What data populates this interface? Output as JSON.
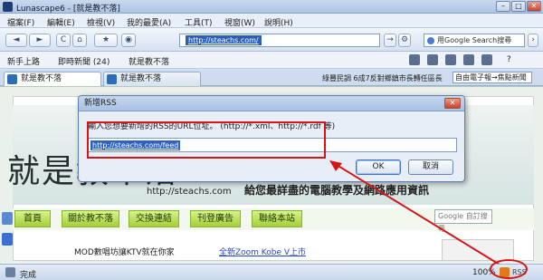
{
  "window": {
    "title": "Lunascape6 - [就是教不落]",
    "minimize": "–",
    "maximize": "□",
    "close": "✕"
  },
  "menu": [
    "檔案(F)",
    "編輯(E)",
    "檢視(V)",
    "我的最愛(A)",
    "工具(T)",
    "視窗(W)",
    "說明(H)"
  ],
  "toolbar": {
    "back": "◄",
    "forward": "►",
    "reload": "C",
    "home": "⌂",
    "favorites": "★",
    "address": "http://steachs.com/",
    "go": "→",
    "stop": "◉",
    "search_placeholder": "用Google Search搜尋"
  },
  "links_bar": {
    "items": [
      "新手上路",
      "即時新聞 (24)",
      "就是教不落"
    ]
  },
  "tabs": [
    {
      "label": "就是教不落"
    },
    {
      "label": "就是教不落"
    }
  ],
  "ticker": {
    "text": "綠豐民調 6成7反對鄉鎮市長轉任區長",
    "source": "自由電子報→焦點新聞"
  },
  "page": {
    "logo": "就是教不落",
    "logo_url": "http://steachs.com",
    "slogan": "給您最詳盡的電腦教學及網路應用資訊",
    "nav": [
      "首頁",
      "關於教不落",
      "交換連結",
      "刊登廣告",
      "聯絡本站"
    ],
    "google_search": "Google 自訂搜尋",
    "news": [
      "MOD數唱坊讓KTV就在你家",
      "全新Zoom Kobe V上市"
    ]
  },
  "dialog": {
    "title": "新增RSS",
    "prompt": "輸入您想要新增的RSS的URL位址。 (http://*.xml、http://*.rdf 等)",
    "input_value": "http://steachs.com/feed",
    "ok": "OK",
    "cancel": "取消",
    "close": "✕"
  },
  "status": {
    "text": "完成",
    "zoom": "100%",
    "rss": "RSS"
  },
  "colors": {
    "highlight": "#d51414",
    "selection": "#2b5fb8",
    "nav_green": "#a4cf3a"
  }
}
